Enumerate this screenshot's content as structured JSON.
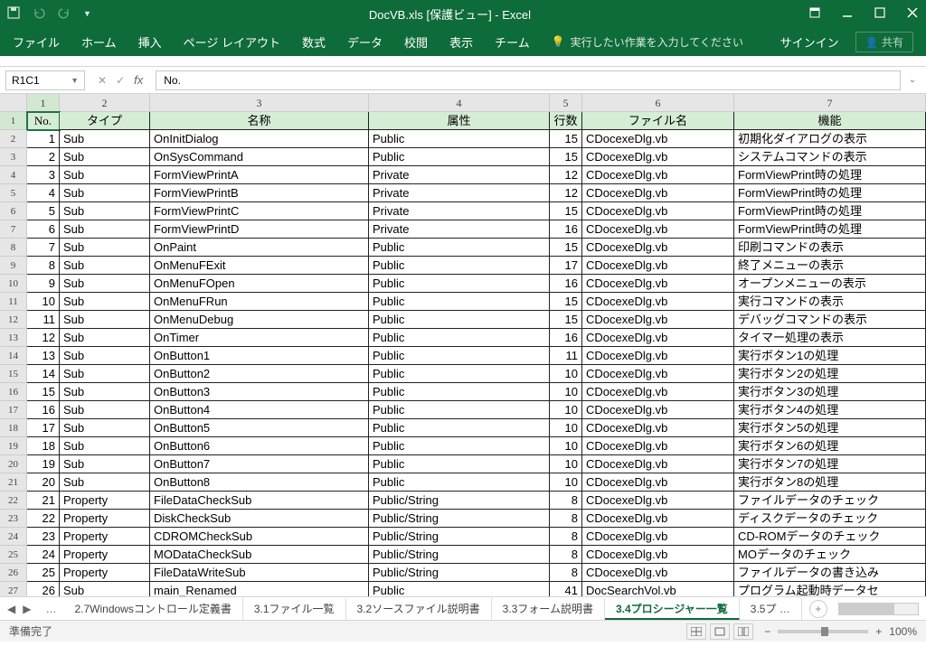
{
  "title": "DocVB.xls [保護ビュー] - Excel",
  "ribbon": {
    "file": "ファイル",
    "home": "ホーム",
    "insert": "挿入",
    "layout": "ページ レイアウト",
    "formulas": "数式",
    "data": "データ",
    "review": "校閲",
    "view": "表示",
    "team": "チーム",
    "tellme": "実行したい作業を入力してください",
    "signin": "サインイン",
    "share": "共有"
  },
  "namebox": "R1C1",
  "fx_value": "No.",
  "col_numbers": [
    "1",
    "2",
    "3",
    "4",
    "5",
    "6",
    "7"
  ],
  "headers": {
    "no": "No.",
    "type": "タイプ",
    "name": "名称",
    "attr": "属性",
    "lines": "行数",
    "file": "ファイル名",
    "func": "機能"
  },
  "rows": [
    {
      "n": "1",
      "t": "Sub",
      "name": "OnInitDialog",
      "attr": "Public",
      "ln": "15",
      "file": "CDocexeDlg.vb",
      "func": "初期化ダイアログの表示"
    },
    {
      "n": "2",
      "t": "Sub",
      "name": "OnSysCommand",
      "attr": "Public",
      "ln": "15",
      "file": "CDocexeDlg.vb",
      "func": "システムコマンドの表示"
    },
    {
      "n": "3",
      "t": "Sub",
      "name": "FormViewPrintA",
      "attr": "Private",
      "ln": "12",
      "file": "CDocexeDlg.vb",
      "func": "FormViewPrint時の処理"
    },
    {
      "n": "4",
      "t": "Sub",
      "name": "FormViewPrintB",
      "attr": "Private",
      "ln": "12",
      "file": "CDocexeDlg.vb",
      "func": "FormViewPrint時の処理"
    },
    {
      "n": "5",
      "t": "Sub",
      "name": "FormViewPrintC",
      "attr": "Private",
      "ln": "15",
      "file": "CDocexeDlg.vb",
      "func": "FormViewPrint時の処理"
    },
    {
      "n": "6",
      "t": "Sub",
      "name": "FormViewPrintD",
      "attr": "Private",
      "ln": "16",
      "file": "CDocexeDlg.vb",
      "func": "FormViewPrint時の処理"
    },
    {
      "n": "7",
      "t": "Sub",
      "name": "OnPaint",
      "attr": "Public",
      "ln": "15",
      "file": "CDocexeDlg.vb",
      "func": "印刷コマンドの表示"
    },
    {
      "n": "8",
      "t": "Sub",
      "name": "OnMenuFExit",
      "attr": "Public",
      "ln": "17",
      "file": "CDocexeDlg.vb",
      "func": "終了メニューの表示"
    },
    {
      "n": "9",
      "t": "Sub",
      "name": "OnMenuFOpen",
      "attr": "Public",
      "ln": "16",
      "file": "CDocexeDlg.vb",
      "func": "オープンメニューの表示"
    },
    {
      "n": "10",
      "t": "Sub",
      "name": "OnMenuFRun",
      "attr": "Public",
      "ln": "15",
      "file": "CDocexeDlg.vb",
      "func": "実行コマンドの表示"
    },
    {
      "n": "11",
      "t": "Sub",
      "name": "OnMenuDebug",
      "attr": "Public",
      "ln": "15",
      "file": "CDocexeDlg.vb",
      "func": "デバッグコマンドの表示"
    },
    {
      "n": "12",
      "t": "Sub",
      "name": "OnTimer",
      "attr": "Public",
      "ln": "16",
      "file": "CDocexeDlg.vb",
      "func": "タイマー処理の表示"
    },
    {
      "n": "13",
      "t": "Sub",
      "name": "OnButton1",
      "attr": "Public",
      "ln": "11",
      "file": "CDocexeDlg.vb",
      "func": "実行ボタン1の処理"
    },
    {
      "n": "14",
      "t": "Sub",
      "name": "OnButton2",
      "attr": "Public",
      "ln": "10",
      "file": "CDocexeDlg.vb",
      "func": "実行ボタン2の処理"
    },
    {
      "n": "15",
      "t": "Sub",
      "name": "OnButton3",
      "attr": "Public",
      "ln": "10",
      "file": "CDocexeDlg.vb",
      "func": "実行ボタン3の処理"
    },
    {
      "n": "16",
      "t": "Sub",
      "name": "OnButton4",
      "attr": "Public",
      "ln": "10",
      "file": "CDocexeDlg.vb",
      "func": "実行ボタン4の処理"
    },
    {
      "n": "17",
      "t": "Sub",
      "name": "OnButton5",
      "attr": "Public",
      "ln": "10",
      "file": "CDocexeDlg.vb",
      "func": "実行ボタン5の処理"
    },
    {
      "n": "18",
      "t": "Sub",
      "name": "OnButton6",
      "attr": "Public",
      "ln": "10",
      "file": "CDocexeDlg.vb",
      "func": "実行ボタン6の処理"
    },
    {
      "n": "19",
      "t": "Sub",
      "name": "OnButton7",
      "attr": "Public",
      "ln": "10",
      "file": "CDocexeDlg.vb",
      "func": "実行ボタン7の処理"
    },
    {
      "n": "20",
      "t": "Sub",
      "name": "OnButton8",
      "attr": "Public",
      "ln": "10",
      "file": "CDocexeDlg.vb",
      "func": "実行ボタン8の処理"
    },
    {
      "n": "21",
      "t": "Property",
      "name": "FileDataCheckSub",
      "attr": "Public/String",
      "ln": "8",
      "file": "CDocexeDlg.vb",
      "func": "ファイルデータのチェック"
    },
    {
      "n": "22",
      "t": "Property",
      "name": "DiskCheckSub",
      "attr": "Public/String",
      "ln": "8",
      "file": "CDocexeDlg.vb",
      "func": "ディスクデータのチェック"
    },
    {
      "n": "23",
      "t": "Property",
      "name": "CDROMCheckSub",
      "attr": "Public/String",
      "ln": "8",
      "file": "CDocexeDlg.vb",
      "func": "CD-ROMデータのチェック"
    },
    {
      "n": "24",
      "t": "Property",
      "name": "MODataCheckSub",
      "attr": "Public/String",
      "ln": "8",
      "file": "CDocexeDlg.vb",
      "func": "MOデータのチェック"
    },
    {
      "n": "25",
      "t": "Property",
      "name": "FileDataWriteSub",
      "attr": "Public/String",
      "ln": "8",
      "file": "CDocexeDlg.vb",
      "func": "ファイルデータの書き込み"
    },
    {
      "n": "26",
      "t": "Sub",
      "name": "main_Renamed",
      "attr": "Public",
      "ln": "41",
      "file": "DocSearchVol.vb",
      "func": "プログラム起動時データセ"
    }
  ],
  "tabs": {
    "t1": "2.7Windowsコントロール定義書",
    "t2": "3.1ファイル一覧",
    "t3": "3.2ソースファイル説明書",
    "t4": "3.3フォーム説明書",
    "t5": "3.4プロシージャー一覧",
    "t6": "3.5プ"
  },
  "status": "準備完了",
  "zoom": "100%"
}
